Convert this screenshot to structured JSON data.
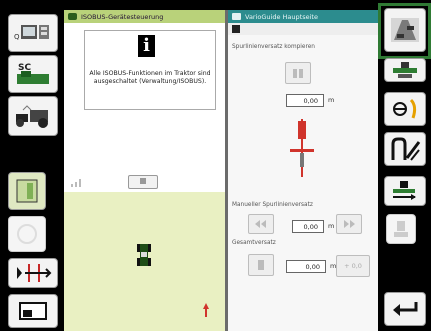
{
  "left_panel": {
    "header_title": "ISOBUS-Gerätesteuerung",
    "info_text": "Alle ISOBUS-Funktionen im Traktor sind ausgeschaltet (Verwaltung/ISOBUS).",
    "info_icon_glyph": "i"
  },
  "right_panel": {
    "header_title": "VarioGuide Hauptseite",
    "track_offset_label": "Spurlinienversatz kompieren",
    "track_offset_value": "0,00",
    "track_offset_unit": "m",
    "manual_offset_label": "Manueller Spurlinienversatz",
    "manual_offset_value": "0,00",
    "manual_offset_unit": "m",
    "total_offset_label": "Gesamtversatz",
    "total_offset_value": "0,00",
    "total_offset_unit": "m",
    "plus_value": "+ 0,0"
  },
  "left_column": {
    "sc_label": "SC"
  },
  "colors": {
    "left_header": "#b9d27a",
    "right_header": "#2c8c8e",
    "selection_frame": "#2f7a34",
    "map_background": "#e9f0c2",
    "offset_marker": "#d0342c"
  }
}
